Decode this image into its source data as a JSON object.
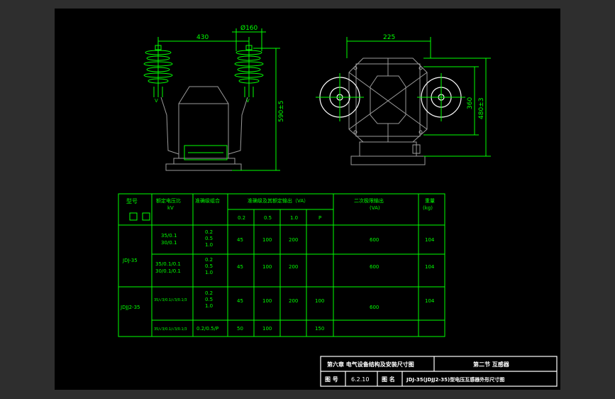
{
  "colors": {
    "background": "#2e2e2e",
    "sheet": "#000000",
    "line": "#00ff00",
    "frame": "#ffffff",
    "body": "#9a9a9a"
  },
  "front_view": {
    "dim_width": "430",
    "dim_diameter": "Ø160",
    "dim_height": "590±5",
    "mark_left": "V",
    "mark_right": "V"
  },
  "side_view": {
    "dim_top": "225",
    "dim_inner": "360",
    "dim_outer": "480±3"
  },
  "table": {
    "headers": {
      "model": "型号",
      "ratio": "额定电压比",
      "ratio_unit": "kV",
      "accuracy": "准确级组合",
      "output": "准确级及其额定输出（VA）",
      "max_output": "二次极限输出",
      "max_output_unit": "(VA)",
      "weight": "重量",
      "weight_unit": "(kg)"
    },
    "sub_headers": [
      "0.2",
      "0.5",
      "1.0",
      "P"
    ],
    "models": [
      "JDJ-35",
      "JDJJ2-35"
    ],
    "rows": [
      {
        "ratio1": "35/0.1",
        "ratio2": "30/0.1",
        "acc": [
          "0.2",
          "0.5",
          "1.0"
        ],
        "v02": "45",
        "v05": "100",
        "v10": "200",
        "vp": "",
        "max": "600",
        "weight": "104"
      },
      {
        "ratio1": "35/0.1/0.1",
        "ratio2": "30/0.1/0.1",
        "acc": [
          "0.2",
          "0.5",
          "1.0"
        ],
        "v02": "45",
        "v05": "100",
        "v10": "200",
        "vp": "",
        "max": "600",
        "weight": "104"
      },
      {
        "ratio1": "35/√3/0.1/√3/0.1/3",
        "ratio2": "",
        "acc": [
          "0.2",
          "0.5",
          "1.0"
        ],
        "v02": "45",
        "v05": "100",
        "v10": "200",
        "vp": "100",
        "max": "600",
        "weight": "104"
      },
      {
        "ratio1": "35/√3/0.1/√3/0.1/3",
        "ratio2": "",
        "acc": [
          "0.2/0.5/P"
        ],
        "v02": "50",
        "v05": "100",
        "v10": "",
        "vp": "150",
        "max": "",
        "weight": ""
      }
    ]
  },
  "title_block": {
    "chapter": "第六章  电气设备结构及安装尺寸图",
    "section": "第二节  互感器",
    "drawing_no_label": "图  号",
    "drawing_no": "6.2.10",
    "drawing_name_label": "图  名",
    "drawing_name": "JDJ-35(JDJJ2-35)型电压互感器外形尺寸图"
  }
}
